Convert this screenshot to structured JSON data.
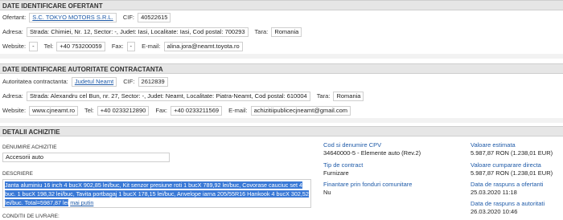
{
  "ofertant": {
    "header": "DATE IDENTIFICARE OFERTANT",
    "ofertant_label": "Ofertant:",
    "ofertant_value": "S.C. TOKYO MOTORS S.R.L.",
    "cif_label": "CIF:",
    "cif_value": "40522615",
    "adresa_label": "Adresa:",
    "adresa_value": "Strada: Chimiei, Nr. 12, Sector: -, Judet: Iasi, Localitate: Iasi, Cod postal: 700293",
    "tara_label": "Tara:",
    "tara_value": "Romania",
    "website_label": "Website:",
    "website_value": "-",
    "tel_label": "Tel:",
    "tel_value": "+40 753200059",
    "fax_label": "Fax:",
    "fax_value": "-",
    "email_label": "E-mail:",
    "email_value": "alina.jora@neamt.toyota.ro"
  },
  "autoritate": {
    "header": "DATE IDENTIFICARE AUTORITATE CONTRACTANTA",
    "autoritate_label": "Autoritatea contractanta:",
    "autoritate_value": "Judetul Neamt",
    "cif_label": "CIF:",
    "cif_value": "2612839",
    "adresa_label": "Adresa:",
    "adresa_value": "Strada: Alexandru cel Bun, nr. 27, Sector: -, Judet: Neamt, Localitate: Piatra-Neamt, Cod postal: 610004",
    "tara_label": "Tara:",
    "tara_value": "Romania",
    "website_label": "Website:",
    "website_value": "www.cjneamt.ro",
    "tel_label": "Tel:",
    "tel_value": "+40 0233212890",
    "fax_label": "Fax:",
    "fax_value": "+40 0233211569",
    "email_label": "E-mail:",
    "email_value": "achizitiipublicecjneamt@gmail.com"
  },
  "achizitie": {
    "header": "DETALII ACHIZITIE",
    "denumire_label": "DENUMIRE ACHIZITIE",
    "denumire_value": "Accesorii auto",
    "descriere_label": "DESCRIERE",
    "descriere_selected": "Janta aluminiu 16 inch 4 bucX 902,85 lei/buc, Kit senzor presiune roti 1 bucX 789,92 lei/buc, Covorase cauciuc set 4 buc. 1 bucX 198,32 lei/buc, Tavita portbagaj 1 bucX 178,15 lei/buc, Anvelope iarna 205/55R16 Hankook 4 bucX 302,52 lei/buc. Total=5987,87 lei",
    "descriere_more": "mai putin",
    "conditii_label": "CONDITII DE LIVRARE:",
    "cpv_label": "Cod si denumire CPV",
    "cpv_value": "34640000-5 - Elemente auto (Rev.2)",
    "tip_label": "Tip de contract",
    "tip_value": "Furnizare",
    "finantare_label": "Finantare prin fonduri comunitare",
    "finantare_value": "Nu",
    "val_est_label": "Valoare estimata",
    "val_est_value": "5.987,87  RON (1.238,01  EUR)",
    "val_cump_label": "Valoare cumparare directa",
    "val_cump_value": "5.987,87  RON (1.238,01  EUR)",
    "data_oferta_label": "Data de raspuns a ofertanti",
    "data_oferta_value": "25.03.2020 11:18",
    "data_autoritate_label": "Data de raspuns a autoritati",
    "data_autoritate_value": "26.03.2020 10:46"
  }
}
